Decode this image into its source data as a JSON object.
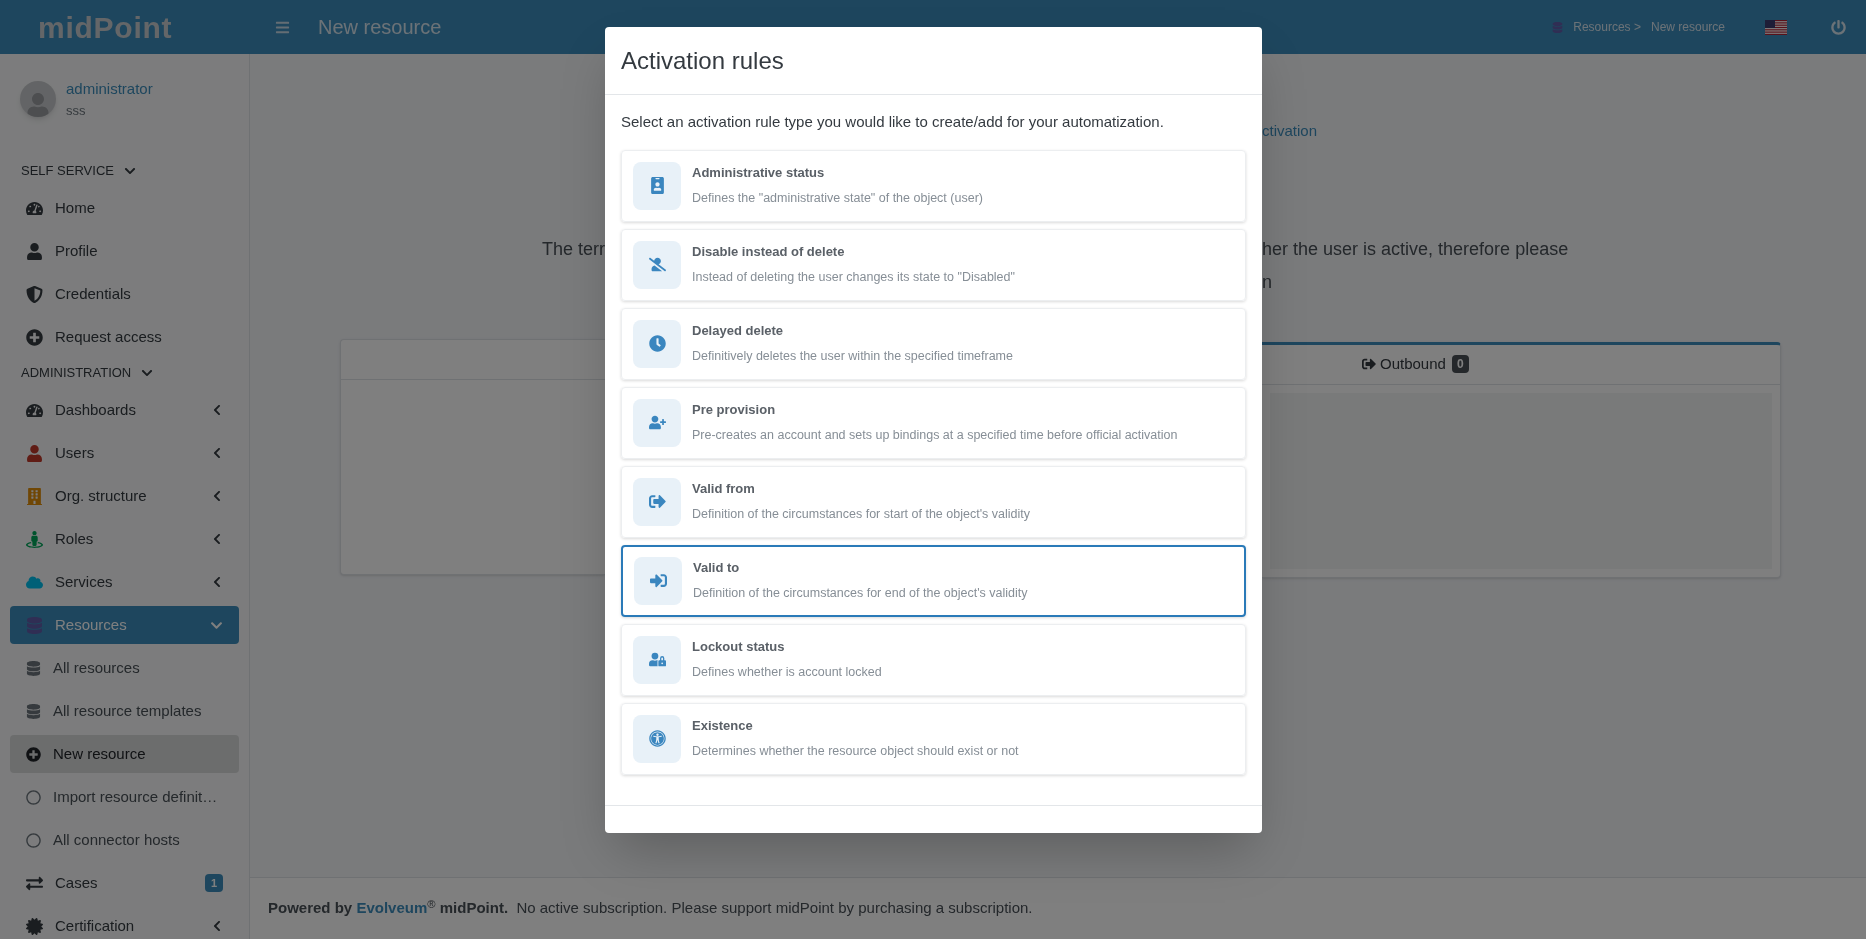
{
  "header": {
    "logo": "midPoint",
    "page_title": "New resource",
    "breadcrumb": [
      {
        "label": "Resources >"
      },
      {
        "label": "New resource"
      }
    ]
  },
  "user": {
    "name": "administrator",
    "subtitle": "sss"
  },
  "sidebar": {
    "sections": [
      {
        "title": "SELF SERVICE",
        "expanded": true,
        "items": [
          {
            "label": "Home",
            "selected": false
          },
          {
            "label": "Profile",
            "selected": false
          },
          {
            "label": "Credentials",
            "selected": false
          },
          {
            "label": "Request access",
            "selected": false
          }
        ]
      },
      {
        "title": "ADMINISTRATION",
        "expanded": true,
        "items": [
          {
            "label": "Dashboards",
            "selected": false,
            "expanded": false
          },
          {
            "label": "Users",
            "selected": false,
            "expanded": false
          },
          {
            "label": "Org. structure",
            "selected": false,
            "expanded": false
          },
          {
            "label": "Roles",
            "selected": false,
            "expanded": false
          },
          {
            "label": "Services",
            "selected": false,
            "expanded": false
          },
          {
            "label": "Resources",
            "selected": true,
            "expanded": true,
            "children": [
              {
                "label": "All resources",
                "selected": false
              },
              {
                "label": "All resource templates",
                "selected": false
              },
              {
                "label": "New resource",
                "selected": true
              },
              {
                "label": "Import resource definit…",
                "selected": false
              },
              {
                "label": "All connector hosts",
                "selected": false
              }
            ]
          },
          {
            "label": "Cases",
            "selected": false,
            "badge": "1"
          },
          {
            "label": "Certification",
            "selected": false,
            "expanded": false
          }
        ]
      }
    ]
  },
  "background": {
    "link_fragment": "ctivation",
    "text_left": "The terr",
    "text_right": [
      "her the user is active, therefore please",
      "n"
    ],
    "tab": {
      "label": "Outbound",
      "count": "0"
    }
  },
  "modal": {
    "title": "Activation rules",
    "description": "Select an activation rule type you would like to create/add for your automatization.",
    "rules": [
      {
        "title": "Administrative status",
        "description": "Defines the \"administrative state\" of the object (user)",
        "selected": false
      },
      {
        "title": "Disable instead of delete",
        "description": "Instead of deleting the user changes its state to \"Disabled\"",
        "selected": false
      },
      {
        "title": "Delayed delete",
        "description": "Definitively deletes the user within the specified timeframe",
        "selected": false
      },
      {
        "title": "Pre provision",
        "description": "Pre-creates an account and sets up bindings at a specified time before official activation",
        "selected": false
      },
      {
        "title": "Valid from",
        "description": "Definition of the circumstances for start of the object's validity",
        "selected": false
      },
      {
        "title": "Valid to",
        "description": "Definition of the circumstances for end of the object's validity",
        "selected": true
      },
      {
        "title": "Lockout status",
        "description": "Defines whether is account locked",
        "selected": false
      },
      {
        "title": "Existence",
        "description": "Determines whether the resource object should exist or not",
        "selected": false
      }
    ]
  },
  "footer": {
    "powered_by": "Powered by",
    "link": "Evolveum",
    "mark": "®",
    "product": "midPoint.",
    "notice": "No active subscription. Please support midPoint by purchasing a subscription."
  }
}
